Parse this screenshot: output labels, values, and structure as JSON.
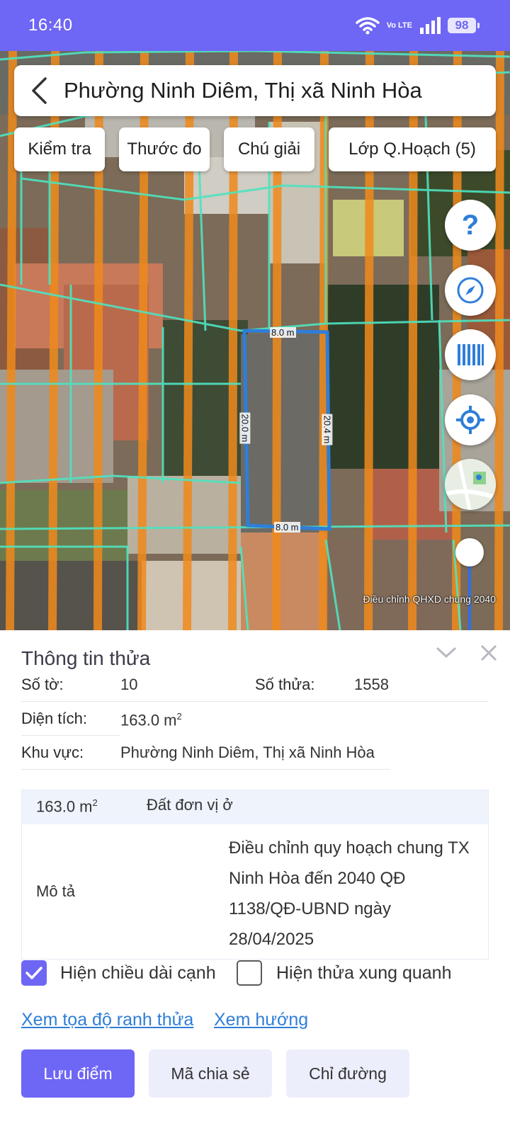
{
  "status_bar": {
    "time": "16:40",
    "network": "Vo LTE",
    "battery": "98"
  },
  "header": {
    "title": "Phường Ninh Diêm, Thị xã Ninh Hòa"
  },
  "toolbar": {
    "check_label": "Kiểm tra",
    "measure_label": "Thước đo",
    "legend_label": "Chú giải",
    "layers_label": "Lớp Q.Hoạch (5)"
  },
  "map": {
    "edge_top": "8.0 m",
    "edge_bottom": "8.0 m",
    "edge_left": "20.0 m",
    "edge_right": "20.4 m",
    "layer_caption": "Điều chỉnh QHXD chung 2040",
    "fab_icons": [
      "help-icon",
      "compass-icon",
      "barcode-icon",
      "locate-icon",
      "map-thumbnail"
    ],
    "parcel_color": "#2f7ed8",
    "boundary_color": "#4fe3c0",
    "planning_color": "#f08a1c"
  },
  "parcel_info": {
    "title": "Thông tin thửa",
    "sheet_label": "Số tờ:",
    "sheet_value": "10",
    "parcel_label": "Số thửa:",
    "parcel_value": "1558",
    "area_label": "Diện tích:",
    "area_value": "163.0 m",
    "area_unit_sup": "2",
    "region_label": "Khu vực:",
    "region_value": "Phường Ninh Diêm, Thị xã Ninh Hòa",
    "table": {
      "area": "163.0 m",
      "area_sup": "2",
      "land_type": "Đất đơn vị ở",
      "desc_label": "Mô tả",
      "desc_value": "Điều chỉnh quy hoạch chung TX Ninh Hòa đến 2040 QĐ 1138/QĐ-UBND ngày 28/04/2025"
    }
  },
  "options": {
    "show_edges_label": "Hiện chiều dài cạnh",
    "show_edges_checked": true,
    "show_neighbors_label": "Hiện thửa xung quanh",
    "show_neighbors_checked": false
  },
  "links": {
    "coords": "Xem tọa độ ranh thửa",
    "direction": "Xem hướng"
  },
  "actions": {
    "save": "Lưu điểm",
    "share": "Mã chia sẻ",
    "route": "Chỉ đường"
  },
  "colors": {
    "accent": "#6e66f4",
    "link": "#2f7ed8"
  }
}
